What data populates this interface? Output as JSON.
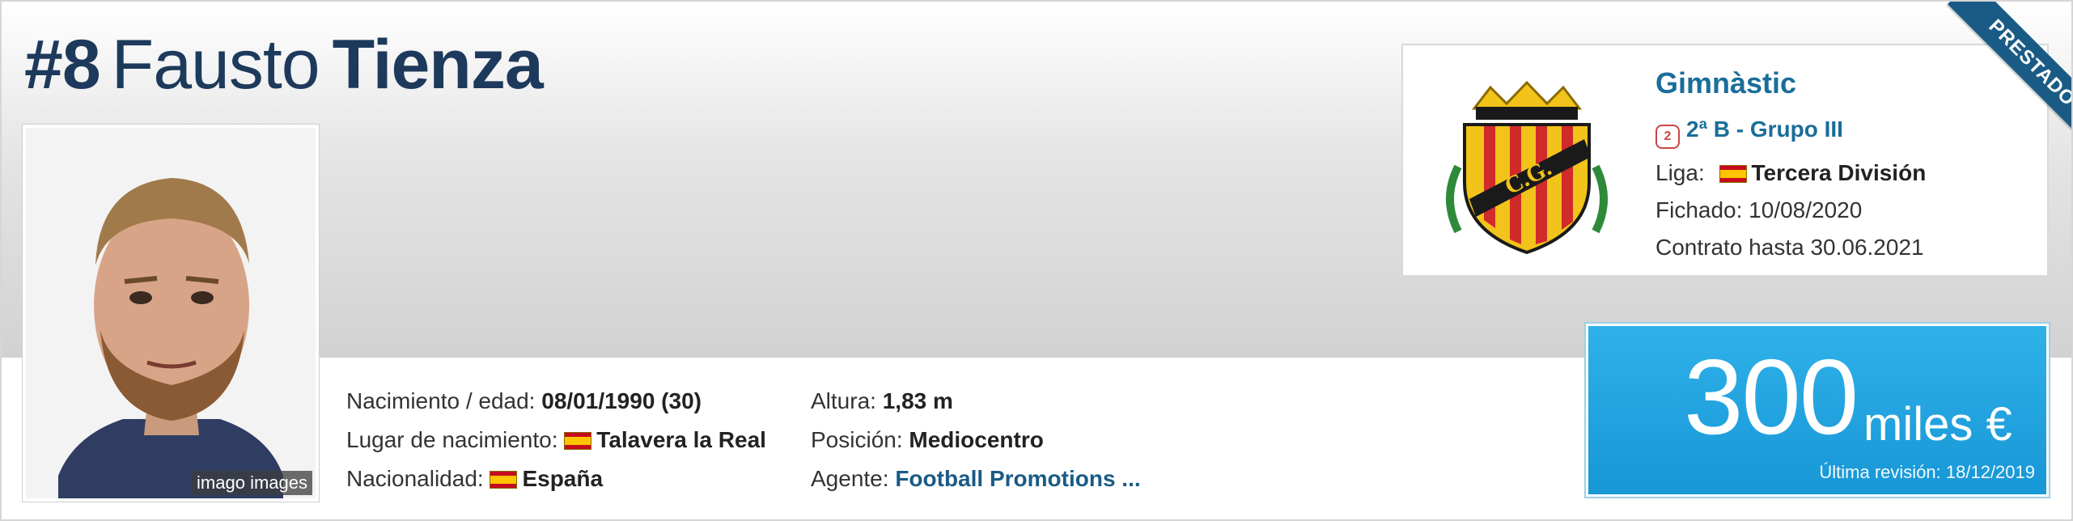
{
  "player": {
    "number": "#8",
    "first_name": "Fausto",
    "last_name": "Tienza",
    "photo_credit": "imago images"
  },
  "details": {
    "birth_label": "Nacimiento / edad:",
    "birth_value": "08/01/1990 (30)",
    "birthplace_label": "Lugar de nacimiento:",
    "birthplace_value": "Talavera la Real",
    "nationality_label": "Nacionalidad:",
    "nationality_value": "España",
    "height_label": "Altura:",
    "height_value": "1,83 m",
    "position_label": "Posición:",
    "position_value": "Mediocentro",
    "agent_label": "Agente:",
    "agent_value": "Football Promotions ..."
  },
  "club": {
    "name": "Gimnàstic",
    "league_icon": "league-badge-icon",
    "league": "2ª B - Grupo III",
    "liga_label": "Liga:",
    "liga_value": "Tercera División",
    "signed": "Fichado: 10/08/2020",
    "contract": "Contrato hasta 30.06.2021",
    "crest_text": "C.G."
  },
  "ribbon": "PRESTADO",
  "market_value": {
    "amount": "300",
    "unit": "miles €",
    "revision": "Última revisión: 18/12/2019"
  },
  "colors": {
    "title": "#1d3a5c",
    "link": "#1a5b86",
    "value_box": "#1797d6"
  }
}
